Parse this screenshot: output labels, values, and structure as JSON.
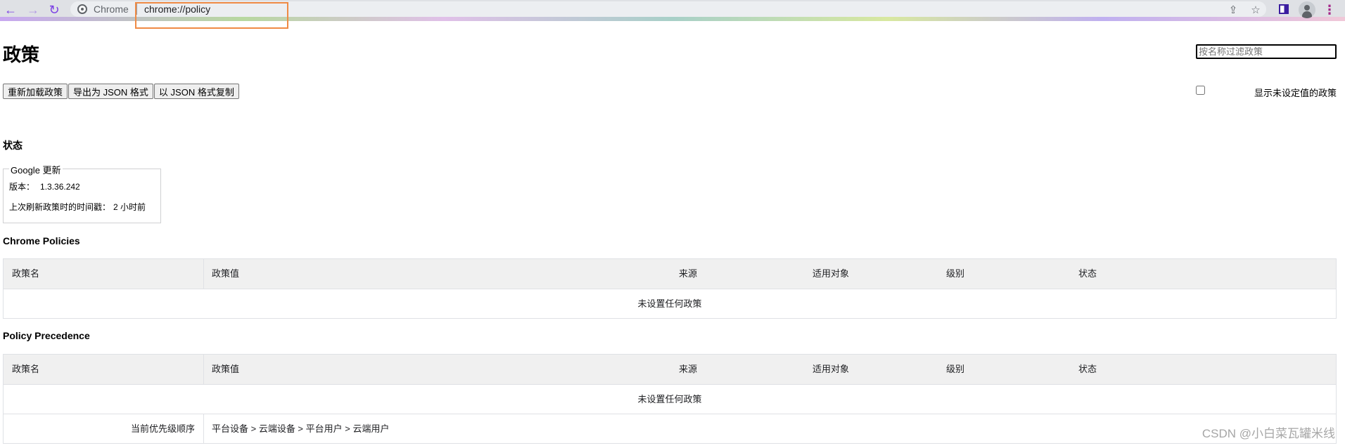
{
  "browser": {
    "site_label": "Chrome",
    "url": "chrome://policy",
    "accent_color": "#7b3fe4",
    "highlight_color": "#ef8a44"
  },
  "page": {
    "title": "政策",
    "filter_placeholder": "按名称过滤政策",
    "buttons": {
      "reload": "重新加载政策",
      "export_json": "导出为 JSON 格式",
      "copy_json": "以 JSON 格式复制"
    },
    "show_unset_label": "显示未设定值的政策",
    "show_unset_checked": false
  },
  "status": {
    "heading": "状态",
    "box_legend": "Google 更新",
    "version_label": "版本：",
    "version_value": "1.3.36.242",
    "last_refresh_label": "上次刷新政策时的时间戳：",
    "last_refresh_value": "2 小时前"
  },
  "columns": {
    "name": "政策名",
    "value": "政策值",
    "source": "来源",
    "scope": "适用对象",
    "level": "级别",
    "status": "状态"
  },
  "chrome_policies": {
    "heading": "Chrome Policies",
    "empty_text": "未设置任何政策"
  },
  "policy_precedence": {
    "heading": "Policy Precedence",
    "empty_text": "未设置任何政策",
    "order_label": "当前优先级顺序",
    "order_value": "平台设备 > 云端设备 > 平台用户 > 云端用户"
  },
  "watermark": "CSDN @小白菜瓦罐米线"
}
